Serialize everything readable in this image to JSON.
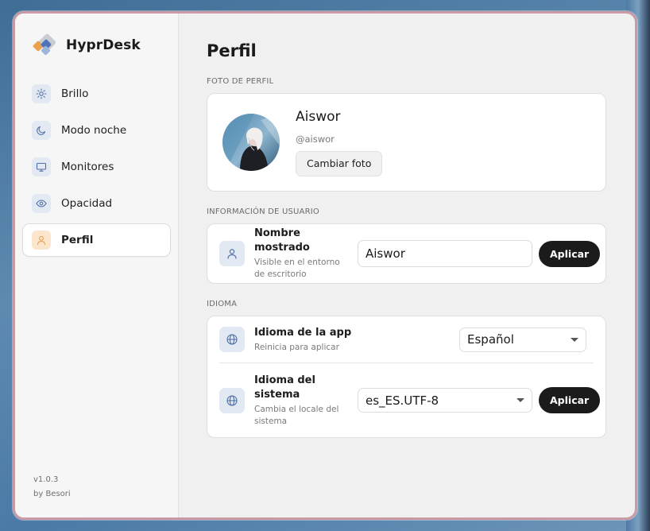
{
  "app": {
    "name": "HyprDesk",
    "version": "v1.0.3",
    "author": "by Besori"
  },
  "sidebar": {
    "items": [
      {
        "label": "Brillo",
        "icon": "sun-icon",
        "active": false
      },
      {
        "label": "Modo noche",
        "icon": "moon-icon",
        "active": false
      },
      {
        "label": "Monitores",
        "icon": "monitor-icon",
        "active": false
      },
      {
        "label": "Opacidad",
        "icon": "eye-icon",
        "active": false
      },
      {
        "label": "Perfil",
        "icon": "user-icon",
        "active": true
      }
    ]
  },
  "page": {
    "title": "Perfil"
  },
  "profile_photo": {
    "section_label": "FOTO DE PERFIL",
    "name": "Aiswor",
    "handle": "@aiswor",
    "change_button": "Cambiar foto"
  },
  "user_info": {
    "section_label": "INFORMACIÓN DE USUARIO",
    "display_name_title": "Nombre mostrado",
    "display_name_sub": "Visible en el entorno de escritorio",
    "display_name_value": "Aiswor",
    "apply_button": "Aplicar"
  },
  "language": {
    "section_label": "IDIOMA",
    "app_lang_title": "Idioma de la app",
    "app_lang_sub": "Reinicia para aplicar",
    "app_lang_value": "Español",
    "sys_lang_title": "Idioma del sistema",
    "sys_lang_sub": "Cambia el locale del sistema",
    "sys_lang_value": "es_ES.UTF-8",
    "apply_button": "Aplicar"
  },
  "colors": {
    "accent_dark": "#1b1b1b",
    "icon_bg": "#e3e9f2",
    "active_icon_bg": "#fbe6cd",
    "icon_blue": "#4f6fa6",
    "icon_orange": "#e9a04f"
  }
}
